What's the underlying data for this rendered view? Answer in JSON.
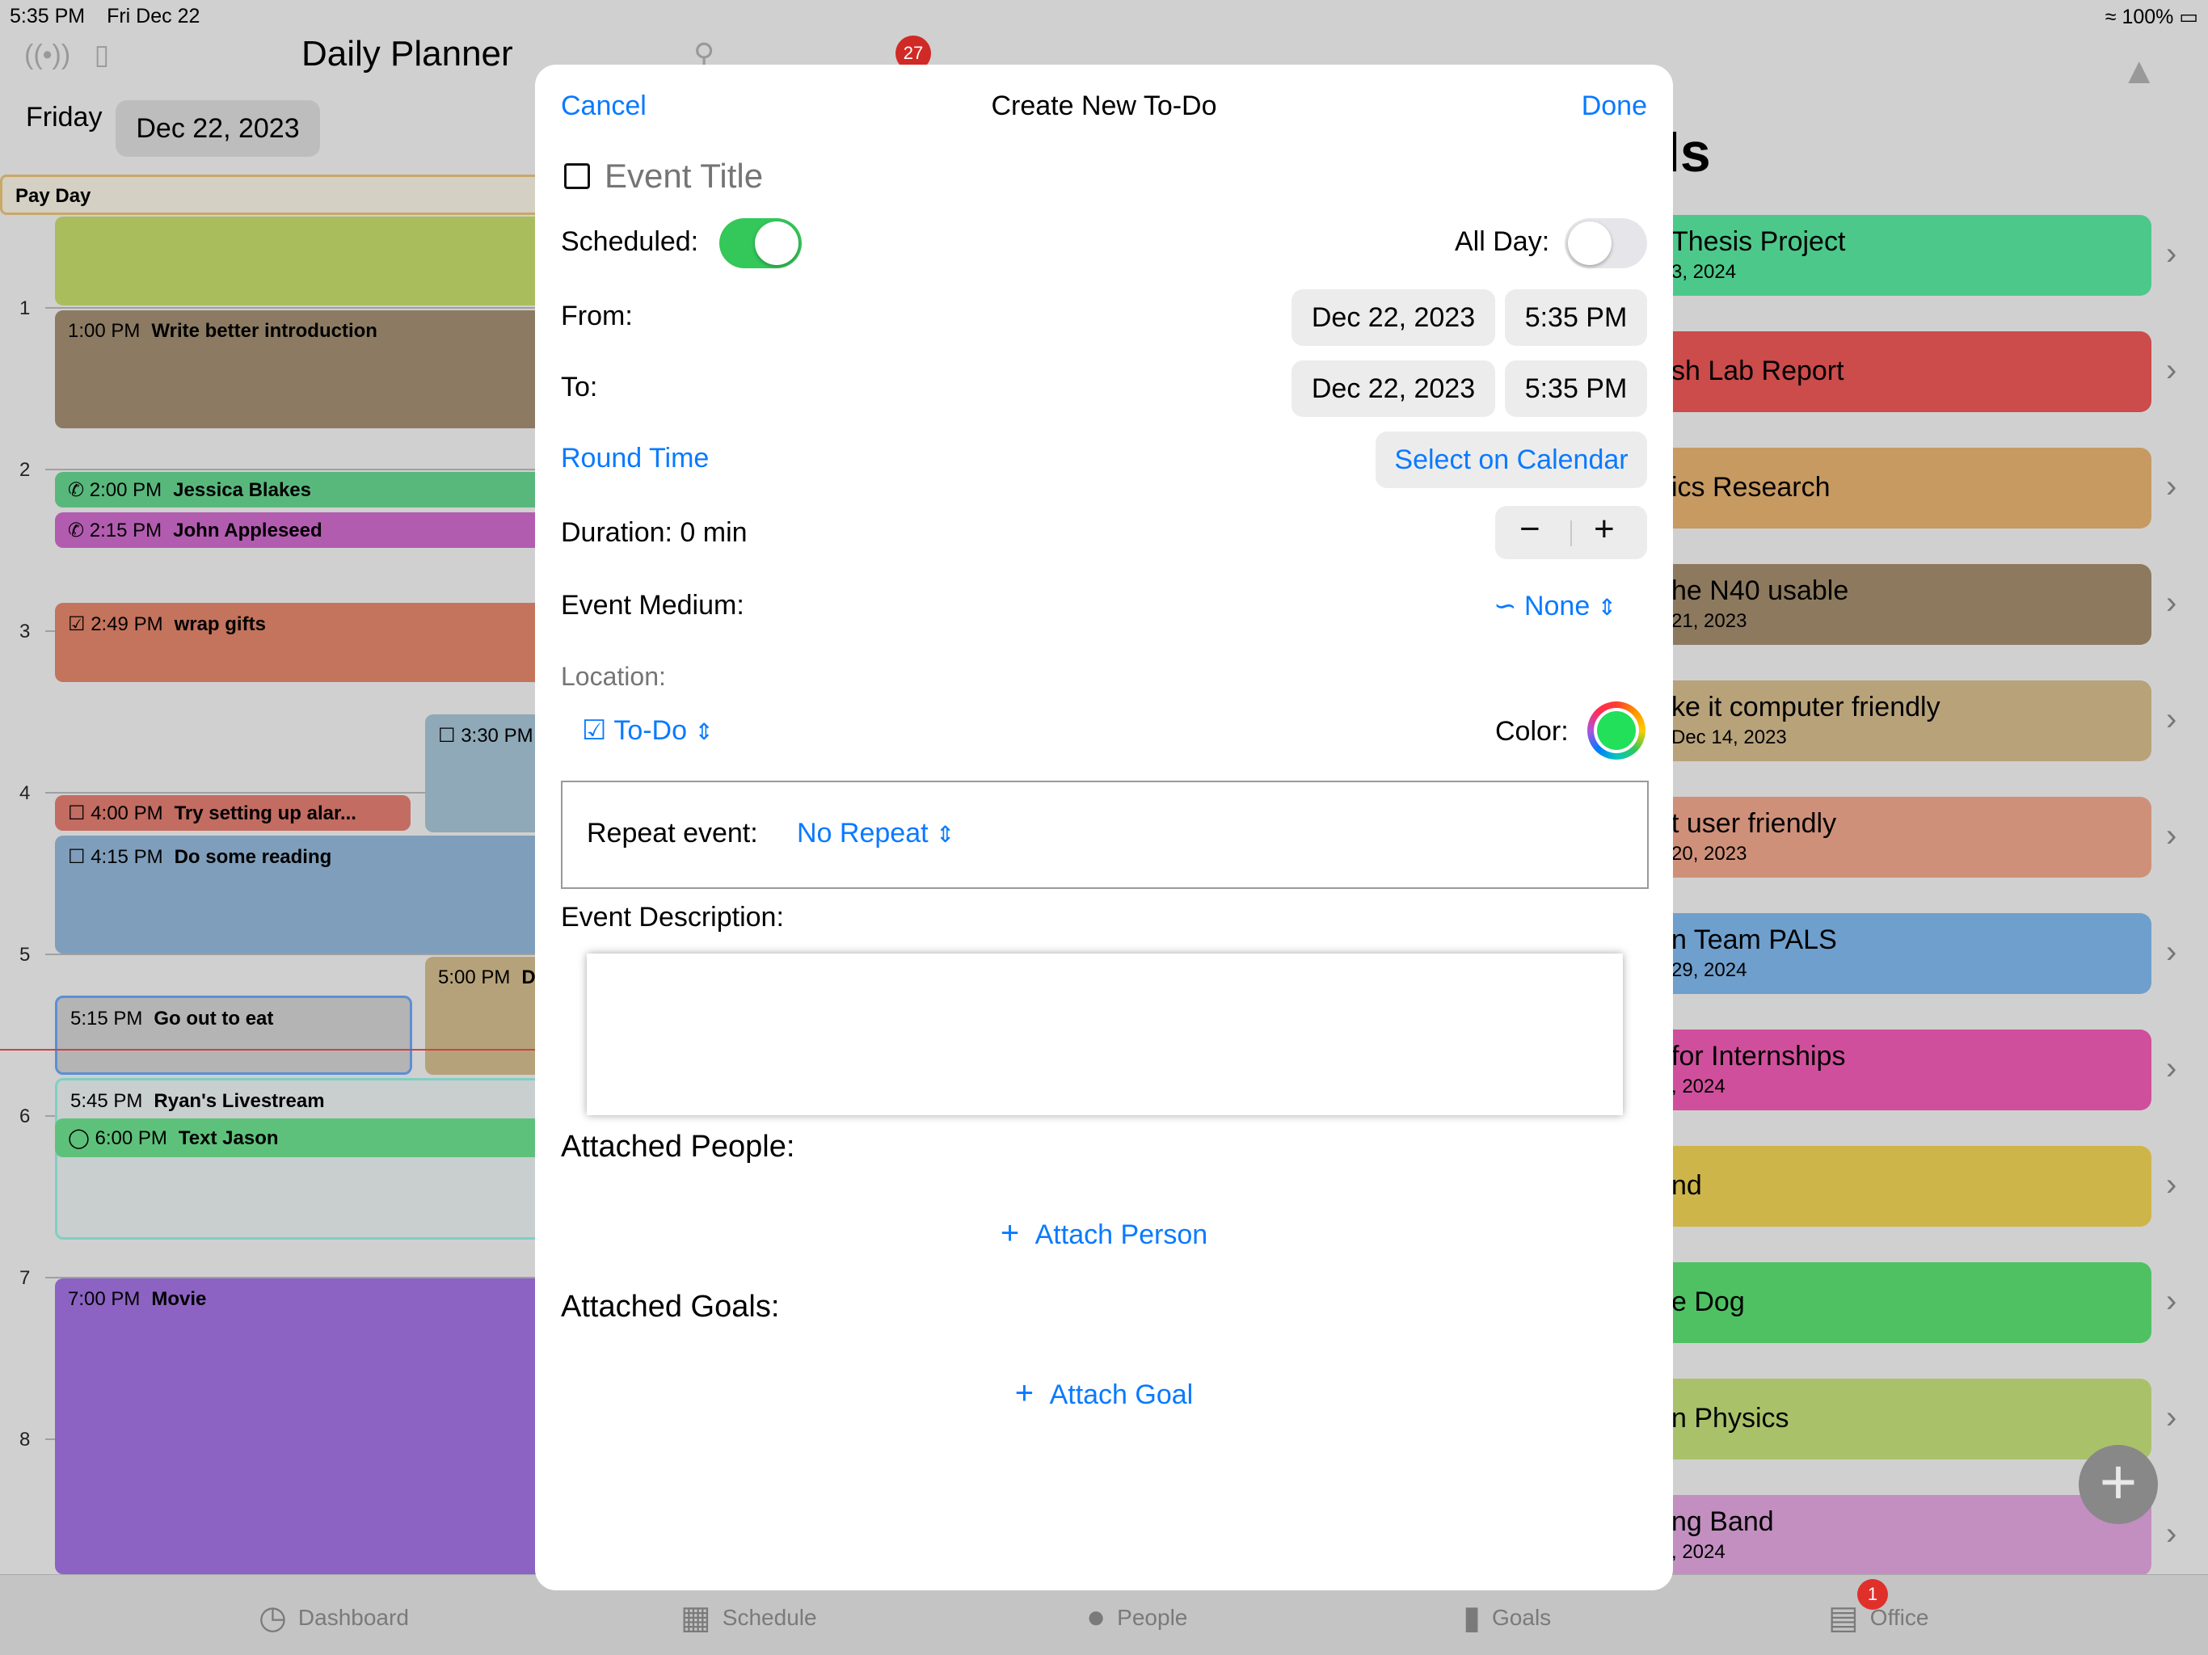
{
  "status_bar": {
    "time": "5:35 PM",
    "date": "Fri Dec 22",
    "battery": "100%"
  },
  "planner": {
    "title": "Daily Planner",
    "weekday": "Friday",
    "date": "Dec 22, 2023",
    "all_day_event": "Pay Day",
    "hours": [
      "1",
      "2",
      "3",
      "4",
      "5",
      "6",
      "7",
      "8"
    ],
    "events": [
      {
        "time": "1:00 PM",
        "title": "Write better introduction"
      },
      {
        "time": "2:00 PM",
        "title": "Jessica Blakes"
      },
      {
        "time": "2:15 PM",
        "title": "John Appleseed"
      },
      {
        "time": "2:49 PM",
        "title": "wrap gifts"
      },
      {
        "time": "3:30 PM",
        "title": ""
      },
      {
        "time": "4:00 PM",
        "title": "Try setting up alar..."
      },
      {
        "time": "4:15 PM",
        "title": "Do some reading"
      },
      {
        "time": "5:00 PM",
        "title": "D"
      },
      {
        "time": "5:15 PM",
        "title": "Go out to eat"
      },
      {
        "time": "5:45 PM",
        "title": "Ryan's Livestream"
      },
      {
        "time": "6:00 PM",
        "title": "Text Jason"
      },
      {
        "time": "7:00 PM",
        "title": "Movie"
      }
    ]
  },
  "notification_badge": "27",
  "goals": {
    "title": "ls",
    "items": [
      {
        "title": "Thesis Project",
        "date": "3, 2024"
      },
      {
        "title": "sh Lab Report",
        "date": ""
      },
      {
        "title": "ics Research",
        "date": ""
      },
      {
        "title": "he N40 usable",
        "date": "21, 2023"
      },
      {
        "title": "ke it computer friendly",
        "date": "Dec 14, 2023"
      },
      {
        "title": "t user friendly",
        "date": "20, 2023"
      },
      {
        "title": "n Team PALS",
        "date": "29, 2024"
      },
      {
        "title": "for Internships",
        "date": ", 2024"
      },
      {
        "title": "nd",
        "date": ""
      },
      {
        "title": "e Dog",
        "date": ""
      },
      {
        "title": "n Physics",
        "date": ""
      },
      {
        "title": "ng Band",
        "date": ", 2024"
      }
    ]
  },
  "tabbar": {
    "dashboard": "Dashboard",
    "schedule": "Schedule",
    "people": "People",
    "goals": "Goals",
    "office": "Office",
    "office_badge": "1"
  },
  "modal": {
    "cancel": "Cancel",
    "title": "Create New To-Do",
    "done": "Done",
    "event_title_placeholder": "Event Title",
    "scheduled_label": "Scheduled:",
    "scheduled_on": true,
    "all_day_label": "All Day:",
    "all_day_on": false,
    "from_label": "From:",
    "from_date": "Dec 22, 2023",
    "from_time": "5:35 PM",
    "to_label": "To:",
    "to_date": "Dec 22, 2023",
    "to_time": "5:35 PM",
    "round_time": "Round Time",
    "select_on_calendar": "Select on Calendar",
    "duration": "Duration: 0 min",
    "event_medium_label": "Event Medium:",
    "event_medium_value": "None",
    "location_placeholder": "Location:",
    "type_value": "To-Do",
    "color_label": "Color:",
    "selected_color": "#22e05a",
    "repeat_label": "Repeat event:",
    "repeat_value": "No Repeat",
    "description_label": "Event Description:",
    "description_value": "",
    "attached_people_label": "Attached People:",
    "attach_person": "Attach Person",
    "attached_goals_label": "Attached Goals:",
    "attach_goal": "Attach Goal"
  },
  "colors": {
    "accent": "#0a7aff",
    "toggle_on": "#34c759",
    "toggle_off": "#e6e6ea"
  }
}
